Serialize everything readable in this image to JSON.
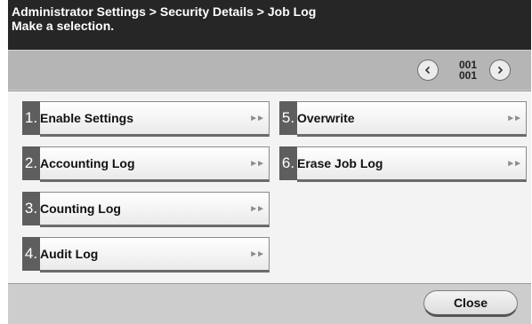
{
  "header": {
    "breadcrumb": "Administrator Settings > Security Details > Job Log",
    "instruction": "Make a selection."
  },
  "pager": {
    "current": "001",
    "total": "001",
    "prev_icon": "chevron-left-icon",
    "next_icon": "chevron-right-icon"
  },
  "menu": {
    "items": [
      {
        "number": "1.",
        "label": "Enable Settings",
        "icon": "double-arrow-right-icon"
      },
      {
        "number": "2.",
        "label": "Accounting Log",
        "icon": "double-arrow-right-icon"
      },
      {
        "number": "3.",
        "label": "Counting Log",
        "icon": "double-arrow-right-icon"
      },
      {
        "number": "4.",
        "label": "Audit Log",
        "icon": "double-arrow-right-icon"
      },
      {
        "number": "5.",
        "label": "Overwrite",
        "icon": "double-arrow-right-icon"
      },
      {
        "number": "6.",
        "label": "Erase Job Log",
        "icon": "double-arrow-right-icon"
      }
    ]
  },
  "footer": {
    "close_label": "Close"
  },
  "colors": {
    "header_bg": "#262626",
    "screen_bg": "#cdcdcd",
    "panel_bg": "#f3f3f3",
    "number_tab_bg": "#5e5e5e"
  }
}
